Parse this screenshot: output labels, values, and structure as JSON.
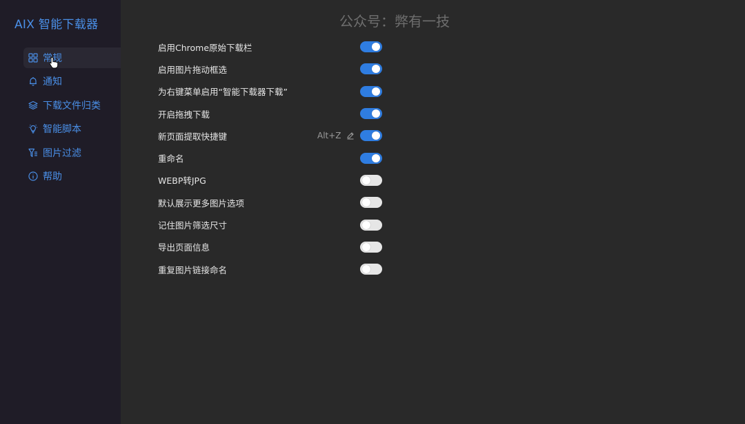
{
  "app": {
    "title": "AIX 智能下载器"
  },
  "watermark": "公众号：弊有一技",
  "accent_color": "#4a8fe7",
  "sidebar": {
    "items": [
      {
        "label": "常规",
        "icon": "grid-icon",
        "active": true
      },
      {
        "label": "通知",
        "icon": "bell-icon",
        "active": false
      },
      {
        "label": "下载文件归类",
        "icon": "layers-icon",
        "active": false
      },
      {
        "label": "智能脚本",
        "icon": "lightbulb-icon",
        "active": false
      },
      {
        "label": "图片过滤",
        "icon": "filter-icon",
        "active": false
      },
      {
        "label": "帮助",
        "icon": "info-icon",
        "active": false
      }
    ]
  },
  "settings": [
    {
      "label": "启用Chrome原始下载栏",
      "enabled": true
    },
    {
      "label": "启用图片拖动框选",
      "enabled": true
    },
    {
      "label": "为右键菜单启用“智能下载器下载”",
      "enabled": true
    },
    {
      "label": "开启拖拽下载",
      "enabled": true
    },
    {
      "label": "新页面提取快捷键",
      "enabled": true,
      "shortcut": "Alt+Z"
    },
    {
      "label": "重命名",
      "enabled": true
    },
    {
      "label": "WEBP转JPG",
      "enabled": false
    },
    {
      "label": "默认展示更多图片选项",
      "enabled": false
    },
    {
      "label": "记住图片筛选尺寸",
      "enabled": false
    },
    {
      "label": "导出页面信息",
      "enabled": false
    },
    {
      "label": "重复图片链接命名",
      "enabled": false
    }
  ]
}
